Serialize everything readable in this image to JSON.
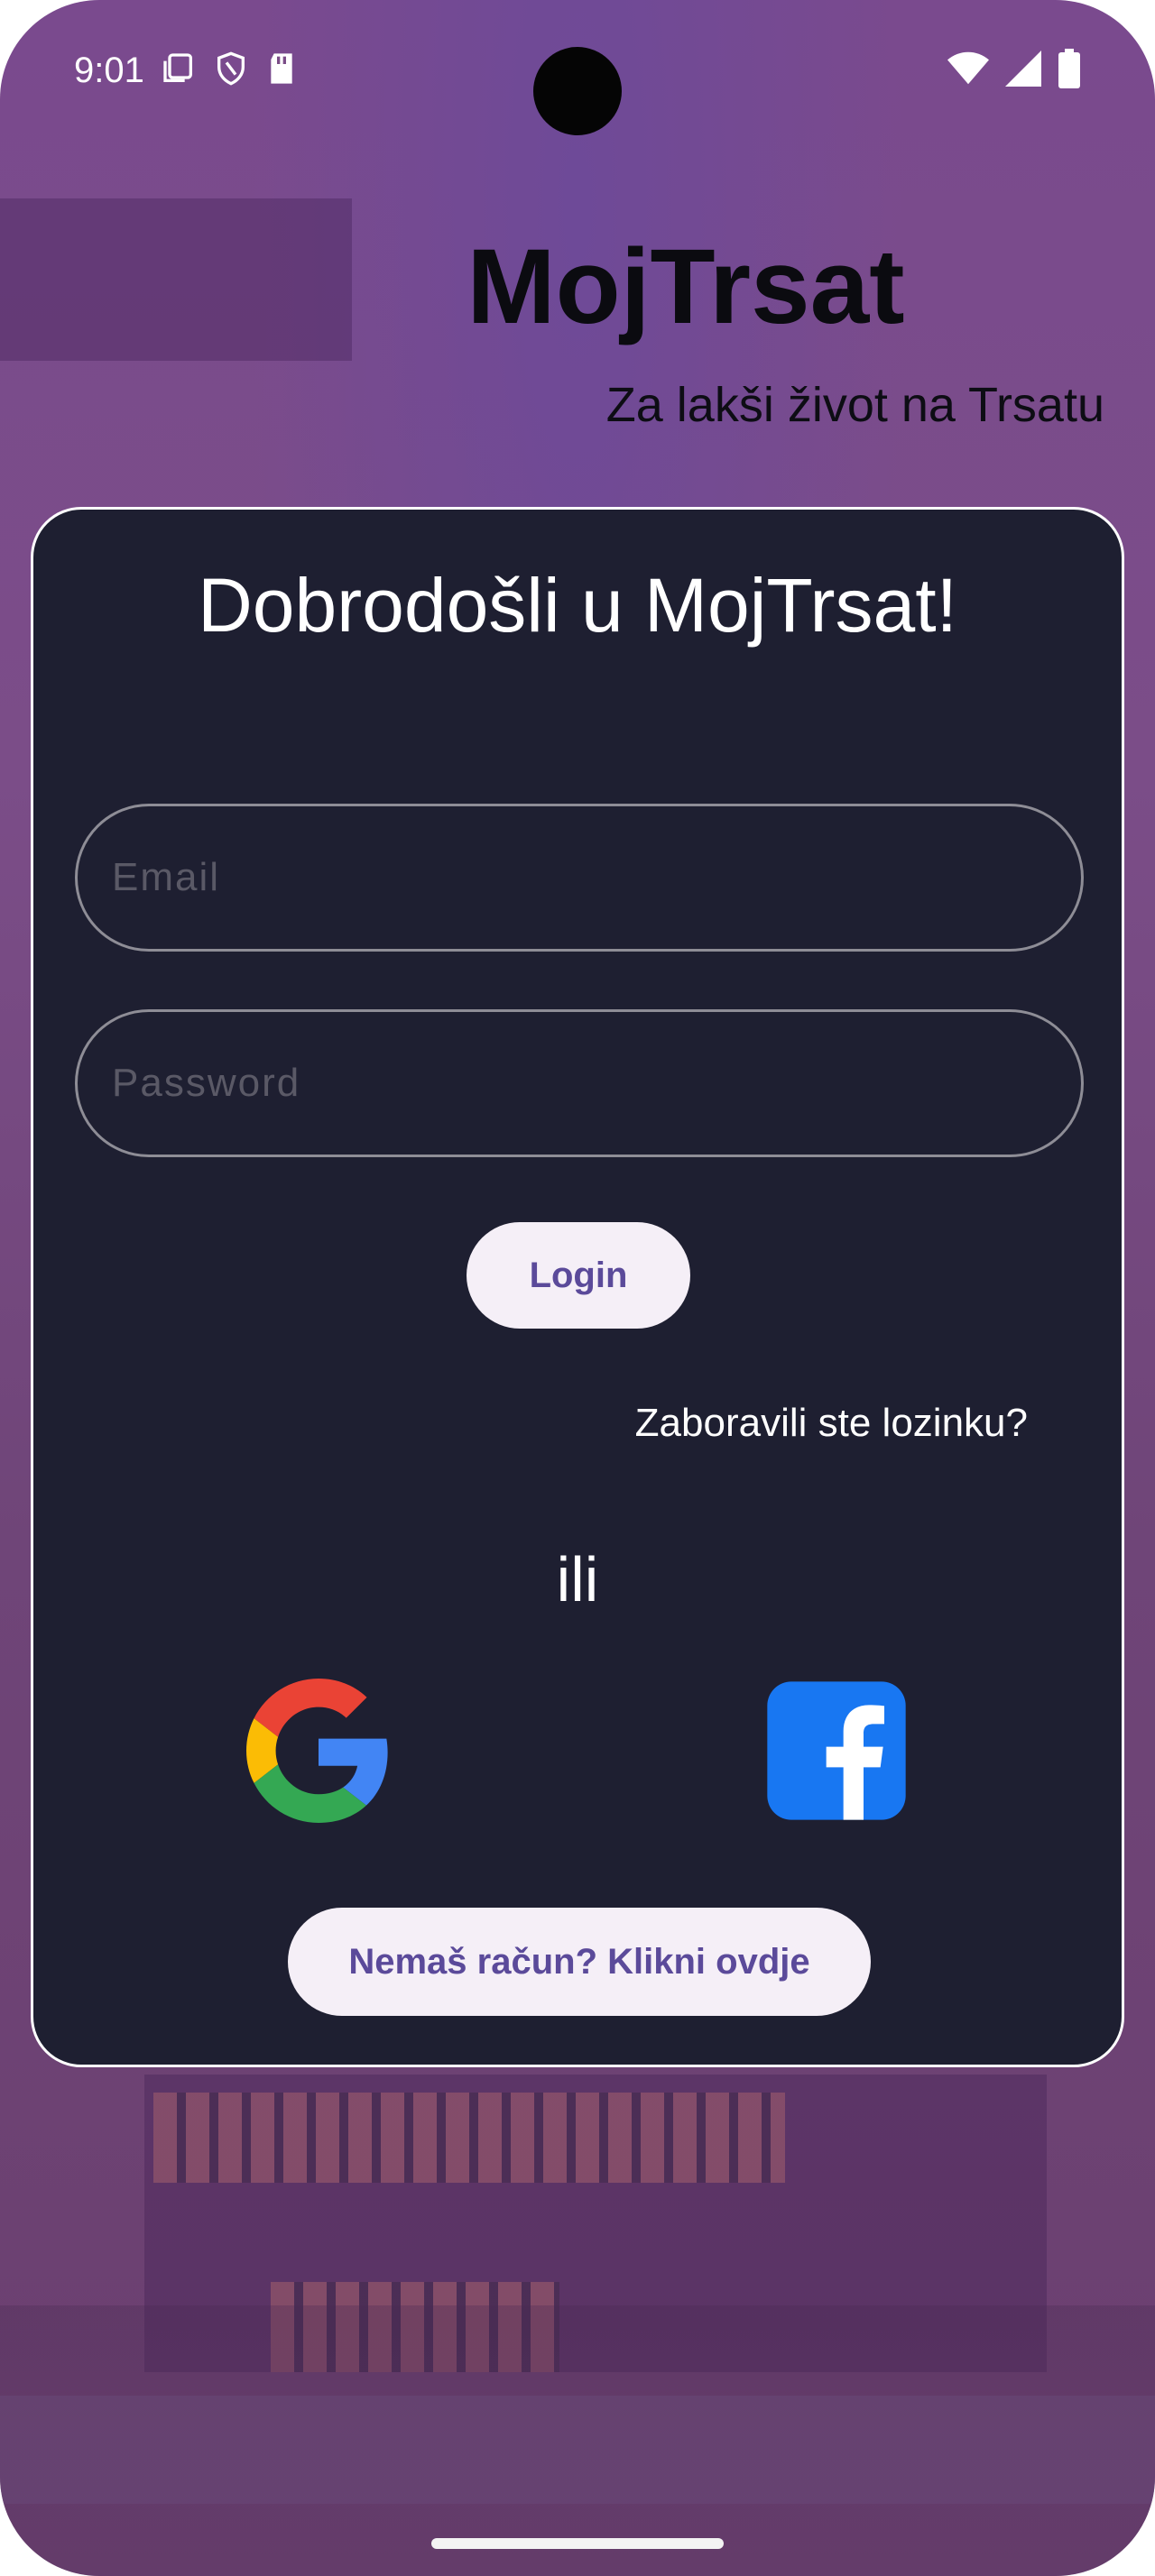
{
  "status_bar": {
    "time": "9:01"
  },
  "app": {
    "title": "MojTrsat",
    "subtitle": "Za lakši život na Trsatu"
  },
  "login_card": {
    "welcome": "Dobrodošli u MojTrsat!",
    "email_placeholder": "Email",
    "password_placeholder": "Password",
    "login_label": "Login",
    "forgot_password": "Zaboravili ste lozinku?",
    "or_label": "ili",
    "social": [
      "google-icon",
      "facebook-icon"
    ],
    "signup_label": "Nemaš račun? Klikni ovdje"
  },
  "colors": {
    "background_tint": "#7b4d88",
    "card_background": "#1e1f31",
    "button_background": "#f5eff7",
    "button_text": "#5b4a9a",
    "facebook_blue": "#1877f2"
  }
}
